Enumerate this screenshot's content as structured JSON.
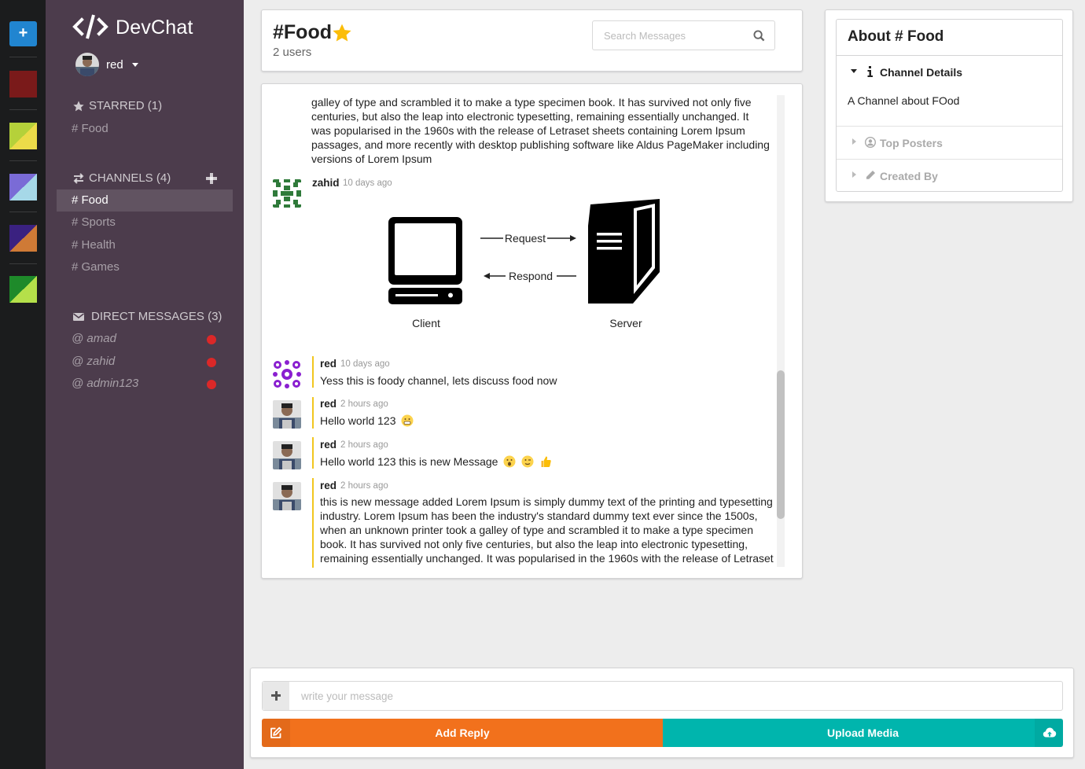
{
  "app": {
    "name": "DevChat"
  },
  "user": {
    "name": "red"
  },
  "rail": {
    "swatches": [
      {
        "colors": [
          "#7a1a1a",
          "#7a1a1a"
        ]
      },
      {
        "colors": [
          "#b5d13a",
          "#ecdb49"
        ]
      },
      {
        "colors": [
          "#7a6bd6",
          "#a6d8e8"
        ]
      },
      {
        "colors": [
          "#3a2180",
          "#cf7a36"
        ]
      },
      {
        "colors": [
          "#1e8a2a",
          "#b5e04a"
        ]
      }
    ]
  },
  "sidebar": {
    "starred": {
      "title": "STARRED (1)",
      "items": [
        {
          "label": "# Food"
        }
      ]
    },
    "channels": {
      "title": "CHANNELS (4)",
      "items": [
        {
          "label": "# Food",
          "active": true
        },
        {
          "label": "# Sports"
        },
        {
          "label": "# Health"
        },
        {
          "label": "# Games"
        }
      ]
    },
    "direct": {
      "title": "DIRECT MESSAGES (3)",
      "items": [
        {
          "label": "@ amad",
          "status": "offline"
        },
        {
          "label": "@ zahid",
          "status": "offline"
        },
        {
          "label": "@ admin123",
          "status": "offline"
        }
      ]
    }
  },
  "header": {
    "channel": "#Food",
    "users": "2 users",
    "search_placeholder": "Search Messages"
  },
  "messages": {
    "overflow_text": "galley of type and scrambled it to make a type specimen book. It has survived not only five centuries, but also the leap into electronic typesetting, remaining essentially unchanged. It was popularised in the 1960s with the release of Letraset sheets containing Lorem Ipsum passages, and more recently with desktop publishing software like Aldus PageMaker including versions of Lorem Ipsum",
    "items": [
      {
        "author": "zahid",
        "time": "10 days ago",
        "image": {
          "left_label": "Client",
          "right_label": "Server",
          "arrow_top": "Request",
          "arrow_bottom": "Respond"
        }
      },
      {
        "author": "red",
        "time": "10 days ago",
        "text": "Yess this is foody channel, lets discuss food now"
      },
      {
        "author": "red",
        "time": "2 hours ago",
        "text": "Hello world 123"
      },
      {
        "author": "red",
        "time": "2 hours ago",
        "text": "Hello world 123 this is new Message"
      },
      {
        "author": "red",
        "time": "2 hours ago",
        "text": "this is new message added Lorem Ipsum is simply dummy text of the printing and typesetting industry. Lorem Ipsum has been the industry's standard dummy text ever since the 1500s, when an unknown printer took a galley of type and scrambled it to make a type specimen book. It has survived not only five centuries, but also the leap into electronic typesetting, remaining essentially unchanged. It was popularised in the 1960s with the release of Letraset"
      }
    ]
  },
  "about": {
    "title": "About # Food",
    "sections": [
      {
        "label": "Channel Details",
        "open": true,
        "content": "A Channel about FOod"
      },
      {
        "label": "Top Posters",
        "open": false
      },
      {
        "label": "Created By",
        "open": false
      }
    ]
  },
  "composer": {
    "placeholder": "write your message",
    "reply_label": "Add Reply",
    "upload_label": "Upload Media"
  },
  "colors": {
    "sidebar": "#4c3c4c",
    "rail": "#1b1c1d",
    "accent_orange": "#f2711c",
    "accent_teal": "#00b5ad",
    "star": "#fbbd08",
    "notify": "#db2828"
  }
}
